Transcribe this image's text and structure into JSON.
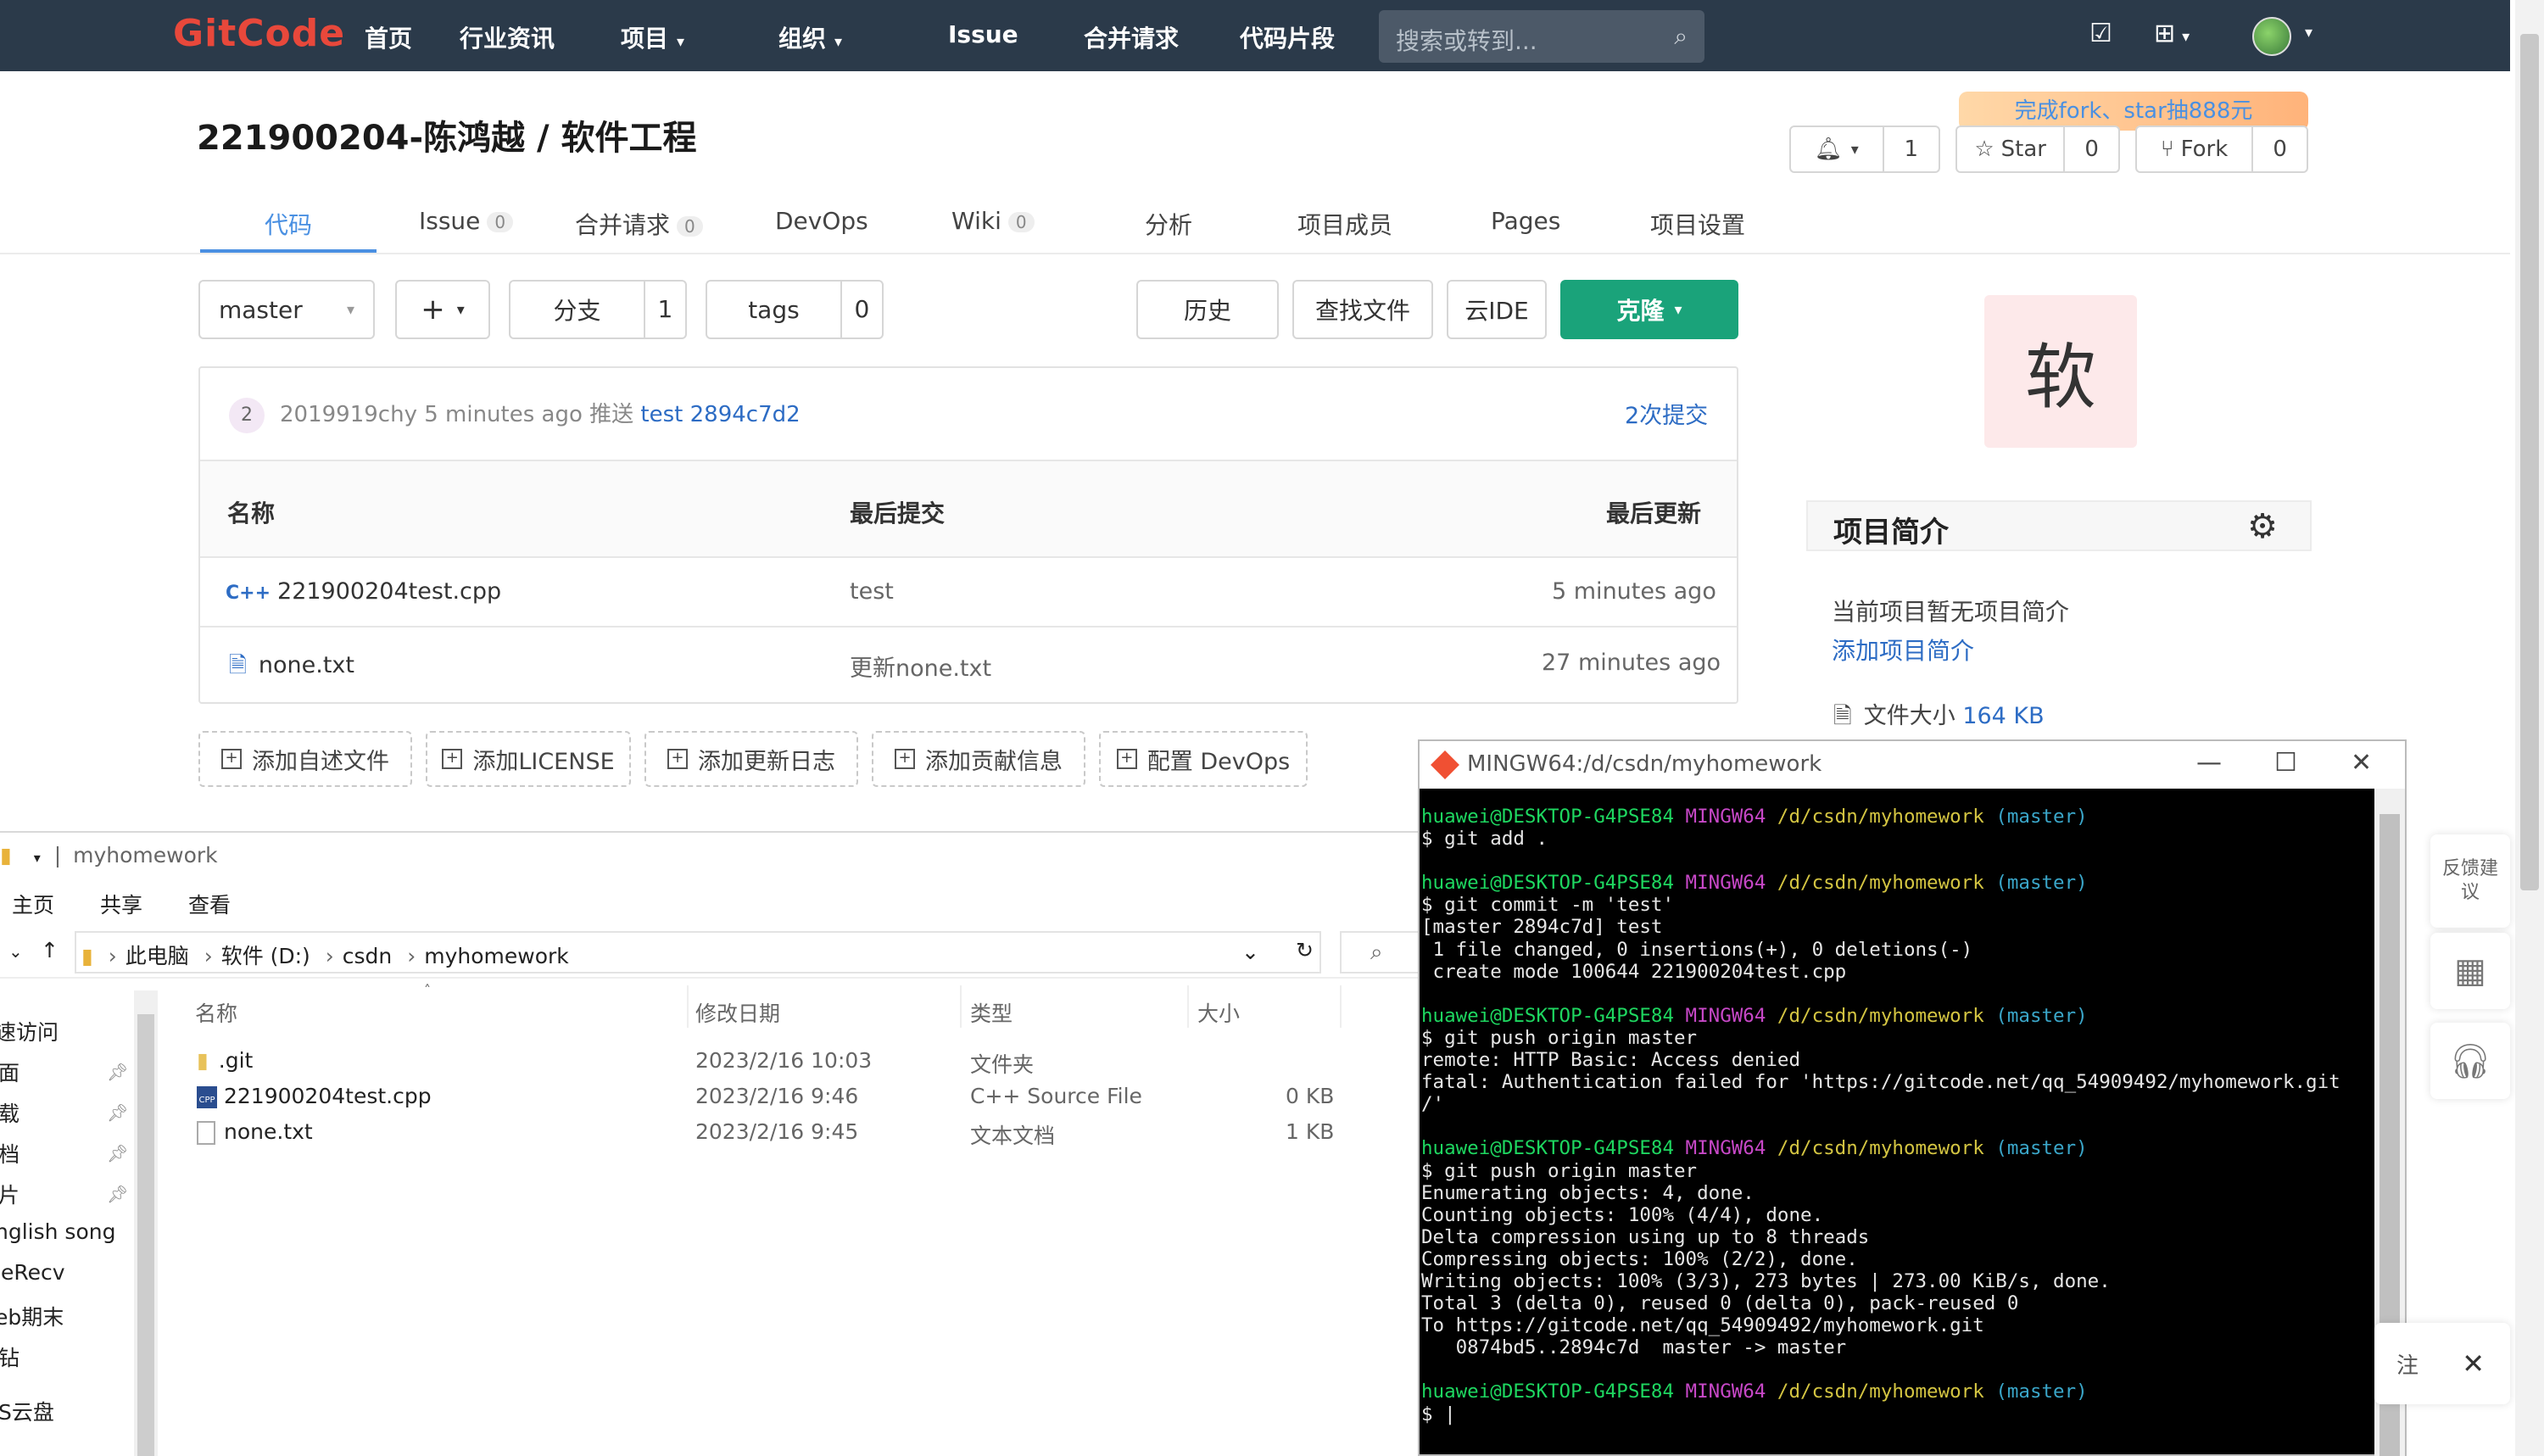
{
  "nav": {
    "logo": "GitCode",
    "items": [
      "首页",
      "行业资讯",
      "项目",
      "组织",
      "Issue",
      "合并请求",
      "代码片段"
    ],
    "search_placeholder": "搜索或转到..."
  },
  "project": {
    "title": "221900204-陈鸿越 / 软件工程",
    "promo": "完成fork、star抽888元",
    "watch_count": "1",
    "star_label": "Star",
    "star_count": "0",
    "fork_label": "Fork",
    "fork_count": "0"
  },
  "tabs": [
    {
      "label": "代码",
      "badge": ""
    },
    {
      "label": "Issue",
      "badge": "0"
    },
    {
      "label": "合并请求",
      "badge": "0"
    },
    {
      "label": "DevOps",
      "badge": ""
    },
    {
      "label": "Wiki",
      "badge": "0"
    },
    {
      "label": "分析",
      "badge": ""
    },
    {
      "label": "项目成员",
      "badge": ""
    },
    {
      "label": "Pages",
      "badge": ""
    },
    {
      "label": "项目设置",
      "badge": ""
    }
  ],
  "toolbar": {
    "branch": "master",
    "branches_label": "分支",
    "branches_count": "1",
    "tags_label": "tags",
    "tags_count": "0",
    "history": "历史",
    "find_file": "查找文件",
    "cloud_ide": "云IDE",
    "clone": "克隆"
  },
  "latest_commit": {
    "avatar_num": "2",
    "text": "2019919chy 5 minutes ago 推送",
    "message": "test",
    "hash": "2894c7d2",
    "count": "2次提交"
  },
  "file_table": {
    "headers": [
      "名称",
      "最后提交",
      "最后更新"
    ],
    "rows": [
      {
        "icon": "cpp-file-icon",
        "name": "221900204test.cpp",
        "commit": "test",
        "updated": "5 minutes ago"
      },
      {
        "icon": "text-file-icon",
        "name": "none.txt",
        "commit": "更新none.txt",
        "updated": "27 minutes ago"
      }
    ]
  },
  "add_buttons": [
    "添加自述文件",
    "添加LICENSE",
    "添加更新日志",
    "添加贡献信息",
    "配置 DevOps"
  ],
  "sidebar": {
    "avatar_char": "软",
    "intro_title": "项目简介",
    "intro_empty": "当前项目暂无项目简介",
    "add_intro": "添加项目简介",
    "file_size_label": "文件大小",
    "file_size": "164 KB"
  },
  "explorer": {
    "title": "myhomework",
    "ribbon": [
      "主页",
      "共享",
      "查看"
    ],
    "path": [
      "此电脑",
      "软件 (D:)",
      "csdn",
      "myhomework"
    ],
    "columns": [
      "名称",
      "修改日期",
      "类型",
      "大小"
    ],
    "files": [
      {
        "icon": "folder-icon",
        "name": ".git",
        "date": "2023/2/16 10:03",
        "type": "文件夹",
        "size": ""
      },
      {
        "icon": "cpp-file-icon",
        "name": "221900204test.cpp",
        "date": "2023/2/16 9:46",
        "type": "C++ Source File",
        "size": "0 KB"
      },
      {
        "icon": "text-file-icon",
        "name": "none.txt",
        "date": "2023/2/16 9:45",
        "type": "文本文档",
        "size": "1 KB"
      }
    ],
    "sidebar_items": [
      "速访问",
      "面",
      "载",
      "档",
      "片",
      "nglish song",
      "leRecv",
      "eb期末",
      "钻",
      "S云盘"
    ]
  },
  "terminal": {
    "title": "MINGW64:/d/csdn/myhomework",
    "prompt_user": "huawei@DESKTOP-G4PSE84",
    "prompt_env": "MINGW64",
    "prompt_path": "/d/csdn/myhomework",
    "prompt_branch": "(master)",
    "lines": [
      {
        "kind": "prompt"
      },
      {
        "kind": "out",
        "text": "$ git add ."
      },
      {
        "kind": "blank"
      },
      {
        "kind": "prompt"
      },
      {
        "kind": "out",
        "text": "$ git commit -m 'test'"
      },
      {
        "kind": "out",
        "text": "[master 2894c7d] test"
      },
      {
        "kind": "out",
        "text": " 1 file changed, 0 insertions(+), 0 deletions(-)"
      },
      {
        "kind": "out",
        "text": " create mode 100644 221900204test.cpp"
      },
      {
        "kind": "blank"
      },
      {
        "kind": "prompt"
      },
      {
        "kind": "out",
        "text": "$ git push origin master"
      },
      {
        "kind": "out",
        "text": "remote: HTTP Basic: Access denied"
      },
      {
        "kind": "out",
        "text": "fatal: Authentication failed for 'https://gitcode.net/qq_54909492/myhomework.git"
      },
      {
        "kind": "out",
        "text": "/'"
      },
      {
        "kind": "blank"
      },
      {
        "kind": "prompt"
      },
      {
        "kind": "out",
        "text": "$ git push origin master"
      },
      {
        "kind": "out",
        "text": "Enumerating objects: 4, done."
      },
      {
        "kind": "out",
        "text": "Counting objects: 100% (4/4), done."
      },
      {
        "kind": "out",
        "text": "Delta compression using up to 8 threads"
      },
      {
        "kind": "out",
        "text": "Compressing objects: 100% (2/2), done."
      },
      {
        "kind": "out",
        "text": "Writing objects: 100% (3/3), 273 bytes | 273.00 KiB/s, done."
      },
      {
        "kind": "out",
        "text": "Total 3 (delta 0), reused 0 (delta 0), pack-reused 0"
      },
      {
        "kind": "out",
        "text": "To https://gitcode.net/qq_54909492/myhomework.git"
      },
      {
        "kind": "out",
        "text": "   0874bd5..2894c7d  master -> master"
      },
      {
        "kind": "blank"
      },
      {
        "kind": "prompt"
      },
      {
        "kind": "out",
        "text": "$ |"
      }
    ]
  },
  "floating": {
    "feedback": "反馈建议",
    "close_partial": "注"
  }
}
